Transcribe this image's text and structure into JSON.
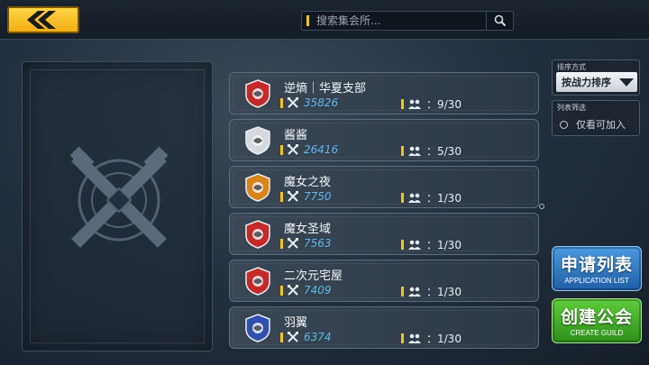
{
  "search": {
    "placeholder": "搜索集会所..."
  },
  "sort": {
    "label": "排序方式",
    "selected": "按战力排序"
  },
  "filter": {
    "label": "列表筛选",
    "option": "仅看可加入"
  },
  "guilds": [
    {
      "name": "逆熵｜华夏支部",
      "power": "35826",
      "members": "：9/30",
      "icon": "badge-icon",
      "color": "#c42a2a"
    },
    {
      "name": "酱酱",
      "power": "26416",
      "members": "：5/30",
      "icon": "badge-icon",
      "color": "#d5d9dd"
    },
    {
      "name": "魔女之夜",
      "power": "7750",
      "members": "：1/30",
      "icon": "badge-icon",
      "color": "#d9851a"
    },
    {
      "name": "魔女圣域",
      "power": "7563",
      "members": "：1/30",
      "icon": "badge-icon",
      "color": "#c42a2a"
    },
    {
      "name": "二次元宅屋",
      "power": "7409",
      "members": "：1/30",
      "icon": "badge-icon",
      "color": "#c42a2a"
    },
    {
      "name": "羽翼",
      "power": "6374",
      "members": "：1/30",
      "icon": "badge-icon",
      "color": "#2f4fb0"
    }
  ],
  "buttons": {
    "apply_cn": "申请列表",
    "apply_en": "APPLICATION LIST",
    "create_cn": "创建公会",
    "create_en": "CREATE GUILD"
  },
  "icons": {
    "back": "chevron-left-icon",
    "search": "search-icon",
    "power": "crossed-swords-icon",
    "members": "people-icon",
    "emblem": "guild-emblem-icon"
  }
}
